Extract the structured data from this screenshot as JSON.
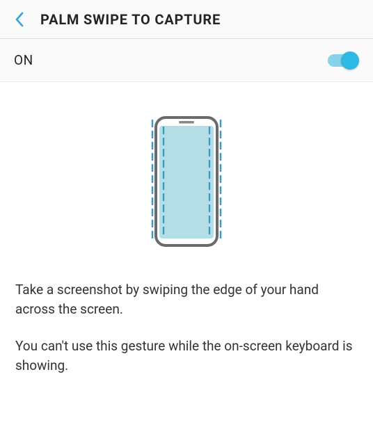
{
  "header": {
    "title": "PALM SWIPE TO CAPTURE"
  },
  "toggle": {
    "label": "ON",
    "state": true
  },
  "description": {
    "paragraph1": "Take a screenshot by swiping the edge of your hand across the screen.",
    "paragraph2": "You can't use this gesture while the on-screen keyboard is showing."
  }
}
